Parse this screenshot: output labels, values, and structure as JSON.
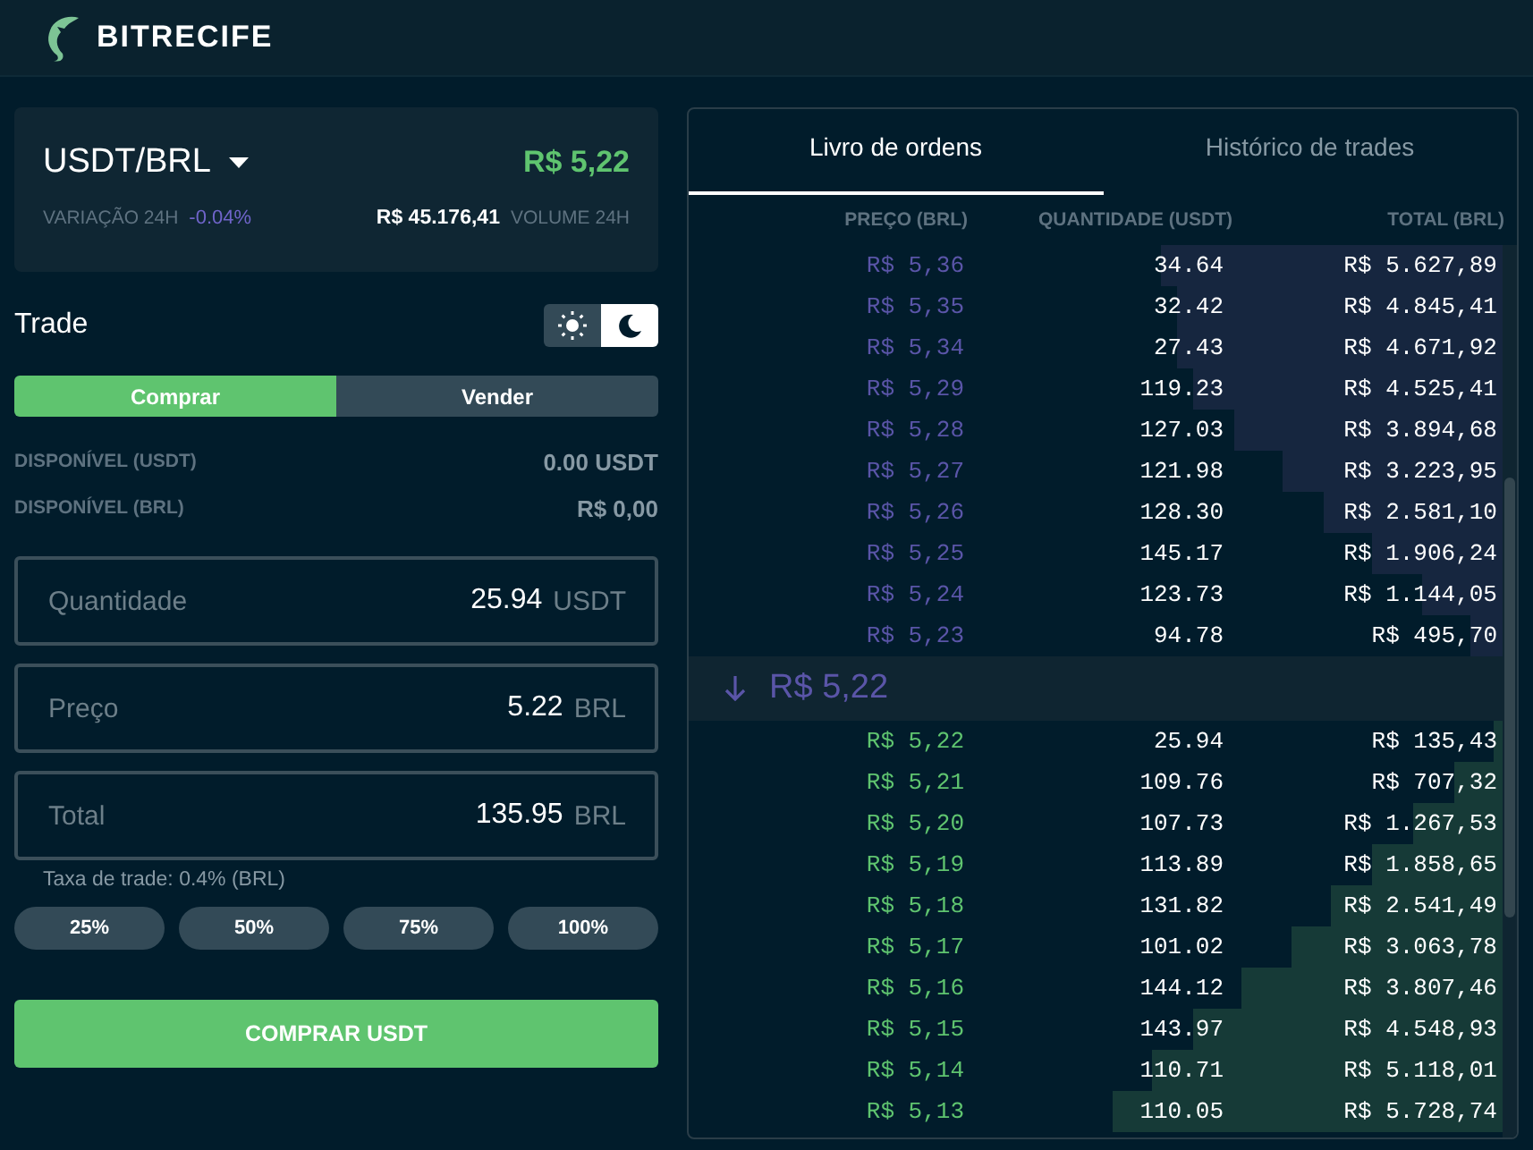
{
  "header": {
    "brand": "BITRECIFE"
  },
  "market": {
    "pair": "USDT/BRL",
    "price": "R$ 5,22",
    "change_label": "VARIAÇÃO 24H",
    "change": "-0.04%",
    "volume": "R$ 45.176,41",
    "volume_label": "VOLUME 24H"
  },
  "trade": {
    "title": "Trade",
    "theme_toggle": [
      {
        "kind": "light",
        "selected": false
      },
      {
        "kind": "dark",
        "selected": true
      }
    ],
    "sides": [
      {
        "label": "Comprar",
        "selected": true
      },
      {
        "label": "Vender",
        "selected": false
      }
    ],
    "balances": [
      {
        "label": "DISPONÍVEL (USDT)",
        "value": "0.00 USDT"
      },
      {
        "label": "DISPONÍVEL (BRL)",
        "value": "R$ 0,00"
      }
    ],
    "fields": [
      {
        "placeholder": "Quantidade",
        "value": "25.94",
        "unit": "USDT"
      },
      {
        "placeholder": "Preço",
        "value": "5.22",
        "unit": "BRL"
      },
      {
        "placeholder": "Total",
        "value": "135.95",
        "unit": "BRL"
      }
    ],
    "fee": "Taxa de trade: 0.4% (BRL)",
    "percent_buttons": [
      "25%",
      "50%",
      "75%",
      "100%"
    ],
    "submit": "COMPRAR USDT"
  },
  "order_book": {
    "tabs": [
      {
        "label": "Livro de ordens",
        "selected": true
      },
      {
        "label": "Histórico de trades",
        "selected": false
      }
    ],
    "columns": [
      "PREÇO (BRL)",
      "QUANTIDADE (USDT)",
      "TOTAL (BRL)"
    ],
    "asks": [
      {
        "price": "R$ 5,36",
        "quantity": "34.64",
        "total": "R$ 5.627,89",
        "level": 0.42
      },
      {
        "price": "R$ 5,35",
        "quantity": "32.42",
        "total": "R$ 4.845,41",
        "level": 0.4
      },
      {
        "price": "R$ 5,34",
        "quantity": "27.43",
        "total": "R$ 4.671,92",
        "level": 0.4
      },
      {
        "price": "R$ 5,29",
        "quantity": "119.23",
        "total": "R$ 4.525,41",
        "level": 0.38
      },
      {
        "price": "R$ 5,28",
        "quantity": "127.03",
        "total": "R$ 3.894,68",
        "level": 0.33
      },
      {
        "price": "R$ 5,27",
        "quantity": "121.98",
        "total": "R$ 3.223,95",
        "level": 0.27
      },
      {
        "price": "R$ 5,26",
        "quantity": "128.30",
        "total": "R$ 2.581,10",
        "level": 0.22
      },
      {
        "price": "R$ 5,25",
        "quantity": "145.17",
        "total": "R$ 1.906,24",
        "level": 0.16
      },
      {
        "price": "R$ 5,24",
        "quantity": "123.73",
        "total": "R$ 1.144,05",
        "level": 0.1
      },
      {
        "price": "R$ 5,23",
        "quantity": "94.78",
        "total": "R$ 495,70",
        "level": 0.04
      }
    ],
    "last_price": {
      "falling": true,
      "price": "R$ 5,22"
    },
    "bids": [
      {
        "price": "R$ 5,22",
        "quantity": "25.94",
        "total": "R$ 135,43",
        "level": 0.01
      },
      {
        "price": "R$ 5,21",
        "quantity": "109.76",
        "total": "R$ 707,32",
        "level": 0.06
      },
      {
        "price": "R$ 5,20",
        "quantity": "107.73",
        "total": "R$ 1.267,53",
        "level": 0.11
      },
      {
        "price": "R$ 5,19",
        "quantity": "113.89",
        "total": "R$ 1.858,65",
        "level": 0.16
      },
      {
        "price": "R$ 5,18",
        "quantity": "131.82",
        "total": "R$ 2.541,49",
        "level": 0.21
      },
      {
        "price": "R$ 5,17",
        "quantity": "101.02",
        "total": "R$ 3.063,78",
        "level": 0.26
      },
      {
        "price": "R$ 5,16",
        "quantity": "144.12",
        "total": "R$ 3.807,46",
        "level": 0.32
      },
      {
        "price": "R$ 5,15",
        "quantity": "143.97",
        "total": "R$ 4.548,93",
        "level": 0.38
      },
      {
        "price": "R$ 5,14",
        "quantity": "110.71",
        "total": "R$ 5.118,01",
        "level": 0.43
      },
      {
        "price": "R$ 5,13",
        "quantity": "110.05",
        "total": "R$ 5.728,74",
        "level": 0.48
      }
    ]
  }
}
